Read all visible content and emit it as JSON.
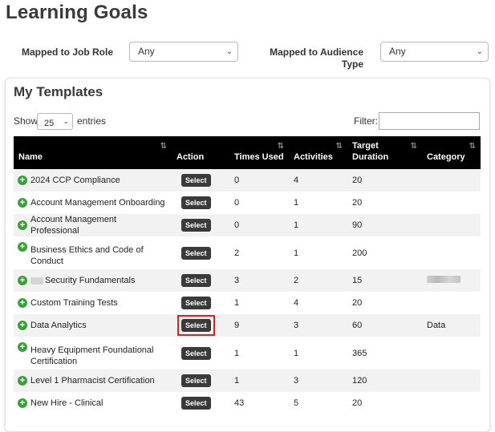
{
  "page": {
    "title": "Learning Goals"
  },
  "filters": {
    "job_role_label": "Mapped to Job Role",
    "job_role_value": "Any",
    "audience_label": "Mapped to Audience Type",
    "audience_value": "Any"
  },
  "templates": {
    "title": "My Templates",
    "show_label": "Show",
    "entries_value": "25",
    "entries_label": "entries",
    "filter_label": "Filter:",
    "filter_value": "",
    "columns": [
      "Name",
      "Action",
      "Times Used",
      "Activities",
      "Target Duration",
      "Category"
    ],
    "select_label": "Select",
    "rows": [
      {
        "name": "2024 CCP Compliance",
        "times_used": "0",
        "activities": "4",
        "target_duration": "20",
        "category": ""
      },
      {
        "name": "Account Management Onboarding",
        "times_used": "0",
        "activities": "1",
        "target_duration": "20",
        "category": ""
      },
      {
        "name": "Account Management Professional",
        "times_used": "0",
        "activities": "1",
        "target_duration": "90",
        "category": ""
      },
      {
        "name": "Business Ethics and Code of Conduct",
        "times_used": "2",
        "activities": "1",
        "target_duration": "200",
        "category": ""
      },
      {
        "name": "Security Fundamentals",
        "times_used": "3",
        "activities": "2",
        "target_duration": "15",
        "category": ""
      },
      {
        "name": "Custom Training Tests",
        "times_used": "1",
        "activities": "4",
        "target_duration": "20",
        "category": ""
      },
      {
        "name": "Data Analytics",
        "times_used": "9",
        "activities": "3",
        "target_duration": "60",
        "category": "Data"
      },
      {
        "name": "Heavy Equipment Foundational Certification",
        "times_used": "1",
        "activities": "1",
        "target_duration": "365",
        "category": ""
      },
      {
        "name": "Level 1 Pharmacist Certification",
        "times_used": "1",
        "activities": "3",
        "target_duration": "120",
        "category": ""
      },
      {
        "name": "New Hire - Clinical",
        "times_used": "43",
        "activities": "5",
        "target_duration": "20",
        "category": ""
      }
    ]
  },
  "colors": {
    "header_bg": "#000000",
    "plus_icon": "#3aa03a",
    "select_button": "#3a3a3a",
    "highlight": "#e02020",
    "row_alt": "#f2f2f2"
  }
}
